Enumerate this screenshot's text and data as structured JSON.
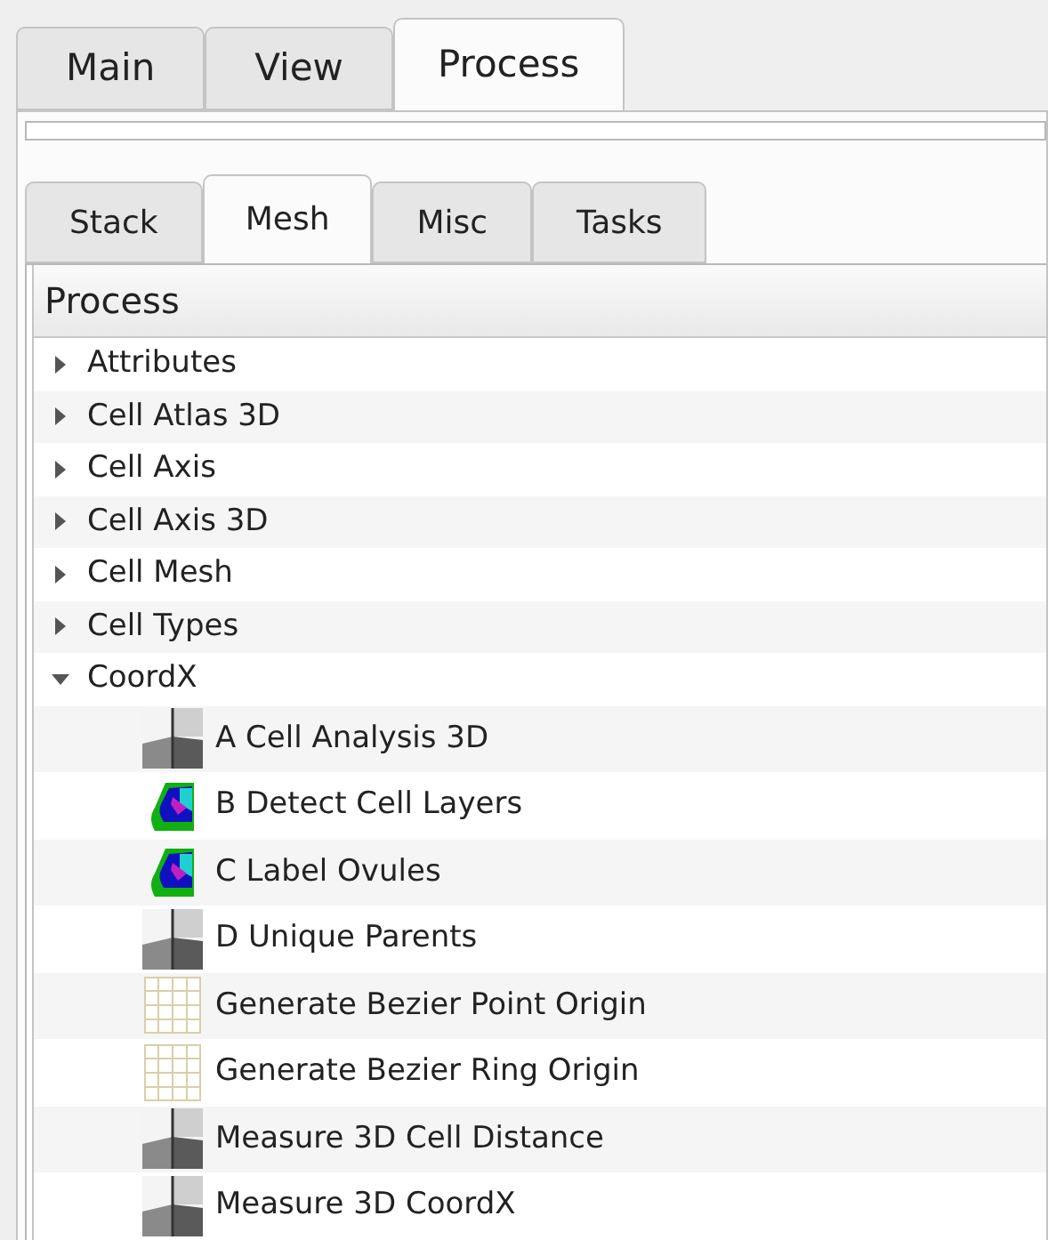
{
  "main_tabs": [
    {
      "label": "Main",
      "selected": false
    },
    {
      "label": "View",
      "selected": false
    },
    {
      "label": "Process",
      "selected": true
    }
  ],
  "sub_tabs": [
    {
      "label": "Stack",
      "selected": false
    },
    {
      "label": "Mesh",
      "selected": true
    },
    {
      "label": "Misc",
      "selected": false
    },
    {
      "label": "Tasks",
      "selected": false
    }
  ],
  "tree": {
    "header": "Process",
    "items": [
      {
        "label": "Attributes",
        "expanded": false
      },
      {
        "label": "Cell Atlas 3D",
        "expanded": false
      },
      {
        "label": "Cell Axis",
        "expanded": false
      },
      {
        "label": "Cell Axis 3D",
        "expanded": false
      },
      {
        "label": "Cell Mesh",
        "expanded": false
      },
      {
        "label": "Cell Types",
        "expanded": false
      },
      {
        "label": "CoordX",
        "expanded": true,
        "children": [
          {
            "label": "A Cell Analysis 3D",
            "kind": "cells"
          },
          {
            "label": "B Detect Cell Layers",
            "kind": "heatmap"
          },
          {
            "label": "C Label Ovules",
            "kind": "heatmap"
          },
          {
            "label": "D Unique Parents",
            "kind": "cells"
          },
          {
            "label": "Generate Bezier Point Origin",
            "kind": "grid"
          },
          {
            "label": "Generate Bezier Ring Origin",
            "kind": "grid"
          },
          {
            "label": "Measure 3D Cell Distance",
            "kind": "cells"
          },
          {
            "label": "Measure 3D CoordX",
            "kind": "cells"
          }
        ]
      }
    ]
  }
}
